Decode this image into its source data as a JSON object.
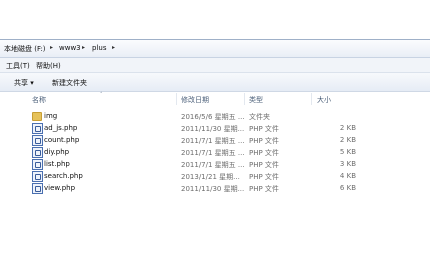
{
  "address": {
    "crumbs": [
      "本地磁盘 (F:)",
      "www3",
      "plus"
    ],
    "separator": "▸"
  },
  "menu": {
    "tools": "工具(T)",
    "help": "帮助(H)"
  },
  "toolbar": {
    "share": "共享 ▾",
    "new_folder": "新建文件夹"
  },
  "columns": {
    "name": "名称",
    "date": "修改日期",
    "type": "类型",
    "size": "大小"
  },
  "files": [
    {
      "name": "img",
      "date": "2016/5/6 星期五 ...",
      "type": "文件夹",
      "size": "",
      "icon": "folder-icon"
    },
    {
      "name": "ad_js.php",
      "date": "2011/11/30 星期...",
      "type": "PHP 文件",
      "size": "2 KB",
      "icon": "php-file-icon"
    },
    {
      "name": "count.php",
      "date": "2011/7/1 星期五 ...",
      "type": "PHP 文件",
      "size": "2 KB",
      "icon": "php-file-icon"
    },
    {
      "name": "diy.php",
      "date": "2011/7/1 星期五 ...",
      "type": "PHP 文件",
      "size": "5 KB",
      "icon": "php-file-icon"
    },
    {
      "name": "list.php",
      "date": "2011/7/1 星期五 ...",
      "type": "PHP 文件",
      "size": "3 KB",
      "icon": "php-file-icon"
    },
    {
      "name": "search.php",
      "date": "2013/1/21 星期...",
      "type": "PHP 文件",
      "size": "4 KB",
      "icon": "php-file-icon"
    },
    {
      "name": "view.php",
      "date": "2011/11/30 星期...",
      "type": "PHP 文件",
      "size": "6 KB",
      "icon": "php-file-icon"
    }
  ]
}
